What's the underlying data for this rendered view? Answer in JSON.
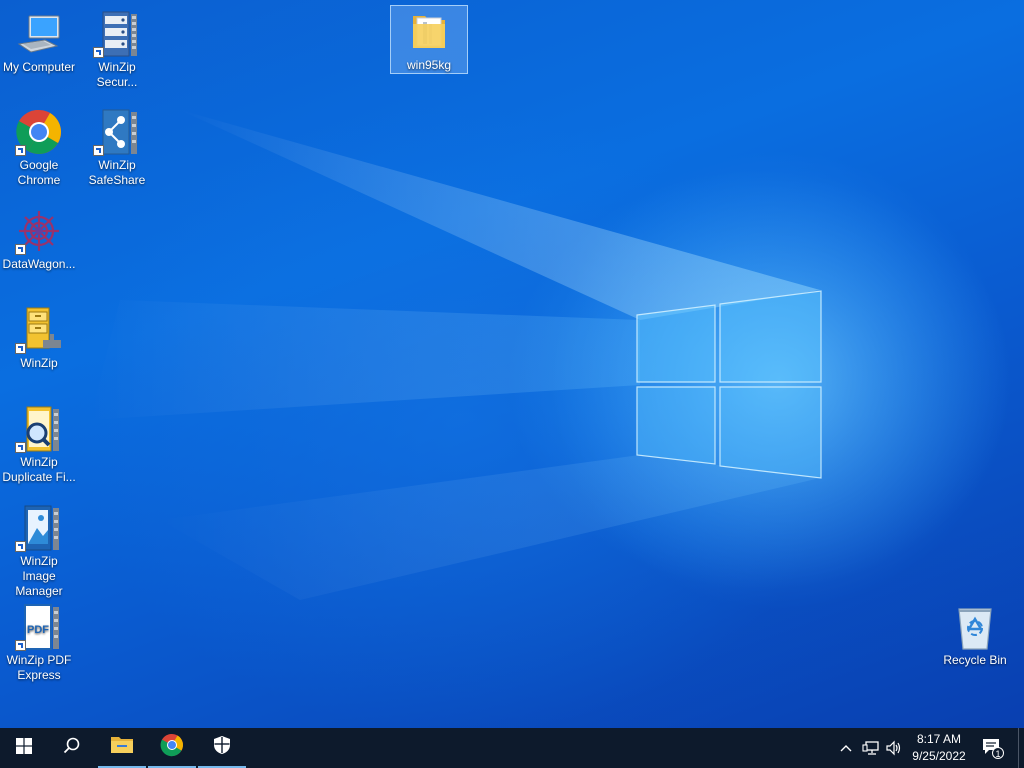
{
  "desktop": {
    "icons": [
      {
        "label": "My Computer"
      },
      {
        "label": "WinZip Secur..."
      },
      {
        "label": "Google Chrome"
      },
      {
        "label": "WinZip SafeShare"
      },
      {
        "label": "DataWagon..."
      },
      {
        "label": "WinZip"
      },
      {
        "label": "WinZip Duplicate Fi..."
      },
      {
        "label": "WinZip Image Manager"
      },
      {
        "label": "WinZip PDF Express"
      },
      {
        "label": "win95kg"
      },
      {
        "label": "Recycle Bin"
      }
    ],
    "selected_icon": "win95kg"
  },
  "taskbar": {
    "pinned": [
      {
        "name": "Start",
        "icon": "windows-logo-icon"
      },
      {
        "name": "Search",
        "icon": "search-icon"
      },
      {
        "name": "File Explorer",
        "icon": "folder-icon",
        "running": true
      },
      {
        "name": "Google Chrome",
        "icon": "chrome-icon",
        "running": true
      },
      {
        "name": "Windows Security",
        "icon": "shield-icon",
        "running": true
      }
    ],
    "tray": {
      "icons": [
        "chevron-up-icon",
        "network-icon",
        "volume-icon"
      ],
      "time": "8:17 AM",
      "date": "9/25/2022",
      "notification_count": "1"
    }
  },
  "colors": {
    "wallpaper_blue": "#0a6ee0",
    "taskbar": "#0d1a2c",
    "active_indicator": "#76b9ed"
  }
}
